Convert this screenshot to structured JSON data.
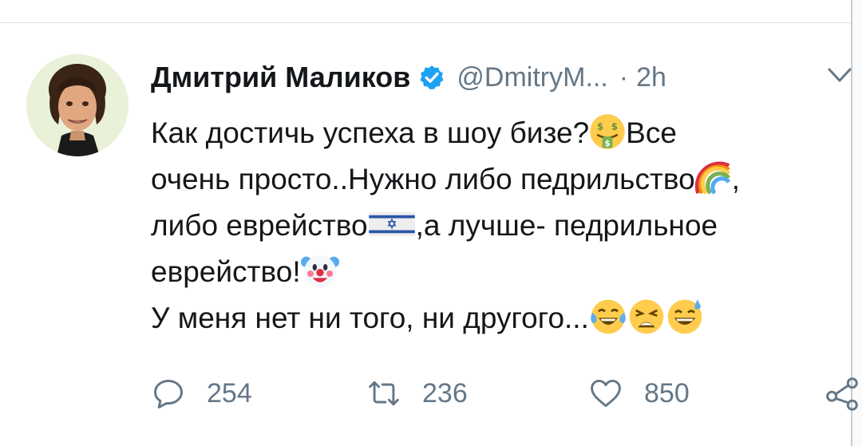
{
  "tweet": {
    "author_name": "Дмитрий Маликов",
    "handle": "@DmitryM...",
    "separator": "·",
    "time": "2h",
    "lines": [
      {
        "before": "Как достичь успеха в шоу бизе?",
        "after": "Все"
      },
      {
        "before": "очень просто..Нужно либо педрильство",
        "after": ","
      },
      {
        "before": "либо еврейство",
        "after": ",а лучше- педрильное"
      },
      {
        "before": "еврейство!",
        "after": ""
      },
      {
        "before": "У меня нет ни того, ни другого...",
        "after": ""
      }
    ],
    "emojis": [
      "money-mouth-face-icon",
      "rainbow-icon",
      "israel-flag-icon",
      "clown-face-icon",
      "tears-of-joy-icon",
      "weary-face-icon",
      "sweat-smile-icon"
    ]
  },
  "actions": {
    "reply_count": "254",
    "retweet_count": "236",
    "like_count": "850"
  },
  "colors": {
    "text": "#14171a",
    "secondary": "#657786",
    "verified": "#1da1f2",
    "divider": "#d9dde2"
  }
}
